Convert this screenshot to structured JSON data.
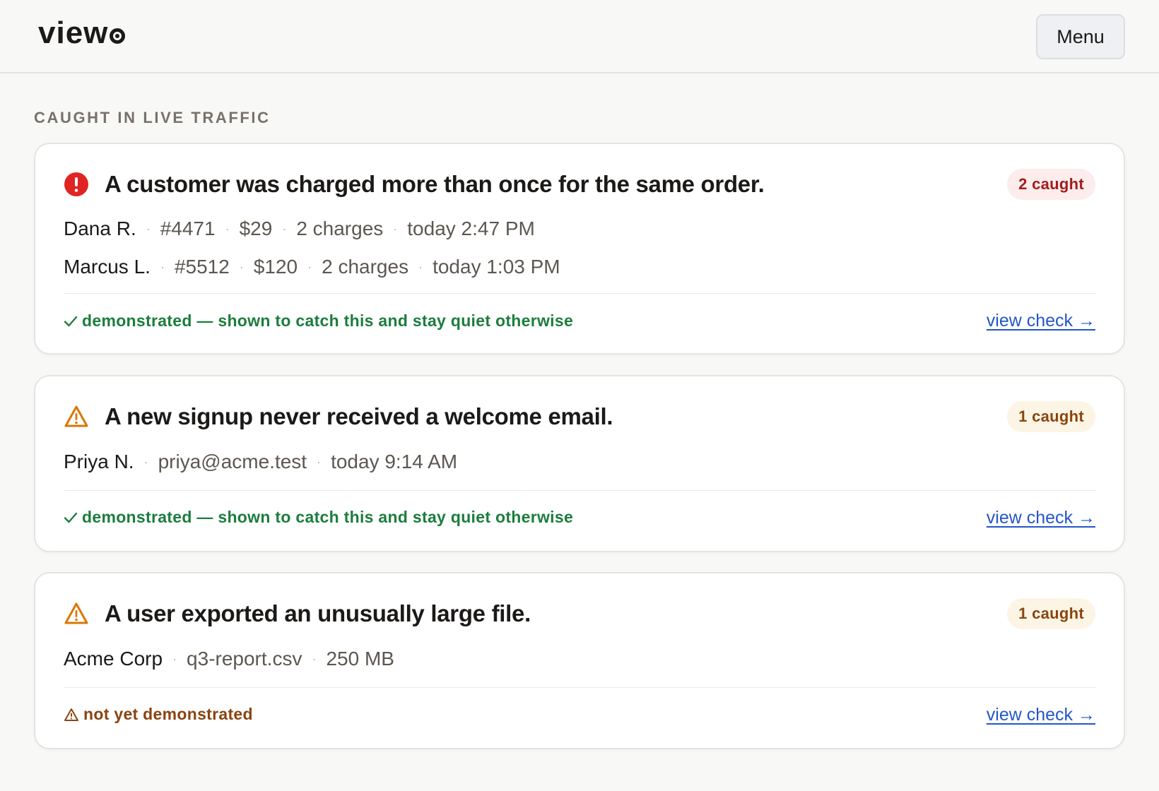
{
  "header": {
    "logo_text": "view",
    "menu_label": "Menu"
  },
  "section_label": "CAUGHT IN LIVE TRAFFIC",
  "colors": {
    "accent_red": "#e02424",
    "accent_amber": "#d97706",
    "ok_green": "#1c7d3d",
    "link_blue": "#2456c8"
  },
  "cards": [
    {
      "severity_icon": "error-circle-icon",
      "title": "A customer was charged more than once for the same order.",
      "badge": "2 caught",
      "rows": [
        {
          "name": "Dana R.",
          "fields": [
            "#4471",
            "$29",
            "2 charges",
            "today 2:47 PM"
          ]
        },
        {
          "name": "Marcus L.",
          "fields": [
            "#5512",
            "$120",
            "2 charges",
            "today 1:03 PM"
          ]
        }
      ],
      "status_icon": "checkmark-icon",
      "status": "demonstrated — shown to catch this and stay quiet otherwise",
      "link": "view check →"
    },
    {
      "severity_icon": "warning-triangle-icon",
      "title": "A new signup never received a welcome email.",
      "badge": "1 caught",
      "rows": [
        {
          "name": "Priya N.",
          "fields": [
            "priya@acme.test",
            "today 9:14 AM"
          ]
        }
      ],
      "status_icon": "checkmark-icon",
      "status": "demonstrated — shown to catch this and stay quiet otherwise",
      "link": "view check →"
    },
    {
      "severity_icon": "warning-triangle-icon",
      "title": "A user exported an unusually large file.",
      "badge": "1 caught",
      "rows": [
        {
          "name": "Acme Corp",
          "fields": [
            "q3-report.csv",
            "250 MB"
          ]
        }
      ],
      "status_icon": "warning-triangle-icon",
      "status": "not yet demonstrated",
      "link": "view check →"
    }
  ]
}
